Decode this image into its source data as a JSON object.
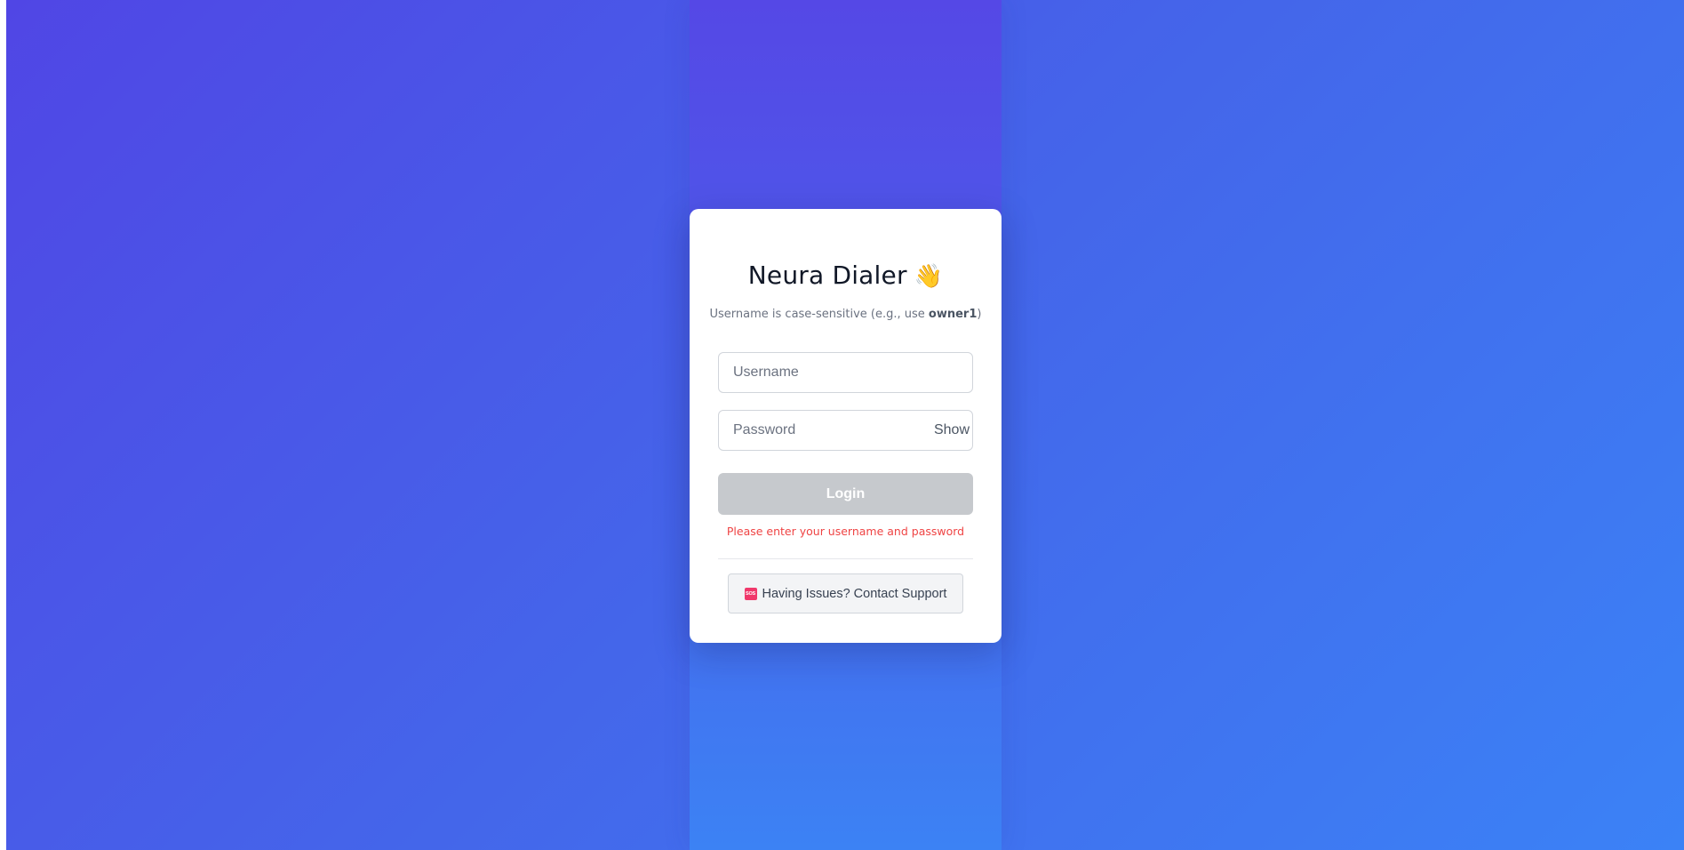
{
  "app": {
    "title": "Neura Dialer",
    "title_icon": "👋",
    "title_icon_name": "waving-hand-icon"
  },
  "hint": {
    "prefix": "Username is case-sensitive (e.g., use ",
    "example": "owner1",
    "suffix": ")"
  },
  "form": {
    "username": {
      "value": "",
      "placeholder": "Username"
    },
    "password": {
      "value": "",
      "placeholder": "Password",
      "toggle_label": "Show"
    },
    "login_label": "Login",
    "login_enabled": false,
    "error_message": "Please enter your username and password"
  },
  "support": {
    "icon_text": "SOS",
    "icon_name": "sos-icon",
    "label": "Having Issues? Contact Support"
  },
  "colors": {
    "gradient_start": "#5046e5",
    "gradient_end": "#3b82f6",
    "error": "#ef4444",
    "login_disabled": "#c6c9cd",
    "sos": "#f0386b"
  }
}
